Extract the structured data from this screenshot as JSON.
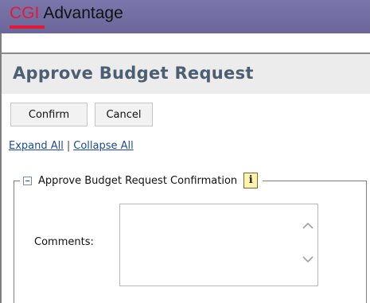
{
  "app": {
    "brand_cgi": "CGI",
    "brand_name": "Advantage"
  },
  "page": {
    "title": "Approve Budget Request"
  },
  "actions": {
    "confirm_label": "Confirm",
    "cancel_label": "Cancel"
  },
  "links": {
    "expand_all": "Expand All",
    "separator": "|",
    "collapse_all": "Collapse All"
  },
  "section": {
    "title": "Approve Budget Request Confirmation",
    "info_icon_glyph": "i",
    "comments_label": "Comments:",
    "comments_value": ""
  },
  "colors": {
    "header_bg": "#6e6aa0",
    "brand_red": "#e31937",
    "title_color": "#4b5e72",
    "link_color": "#1a4b9c"
  },
  "icons": [
    "collapse-icon",
    "info-icon",
    "chevron-up-icon",
    "chevron-down-icon"
  ]
}
